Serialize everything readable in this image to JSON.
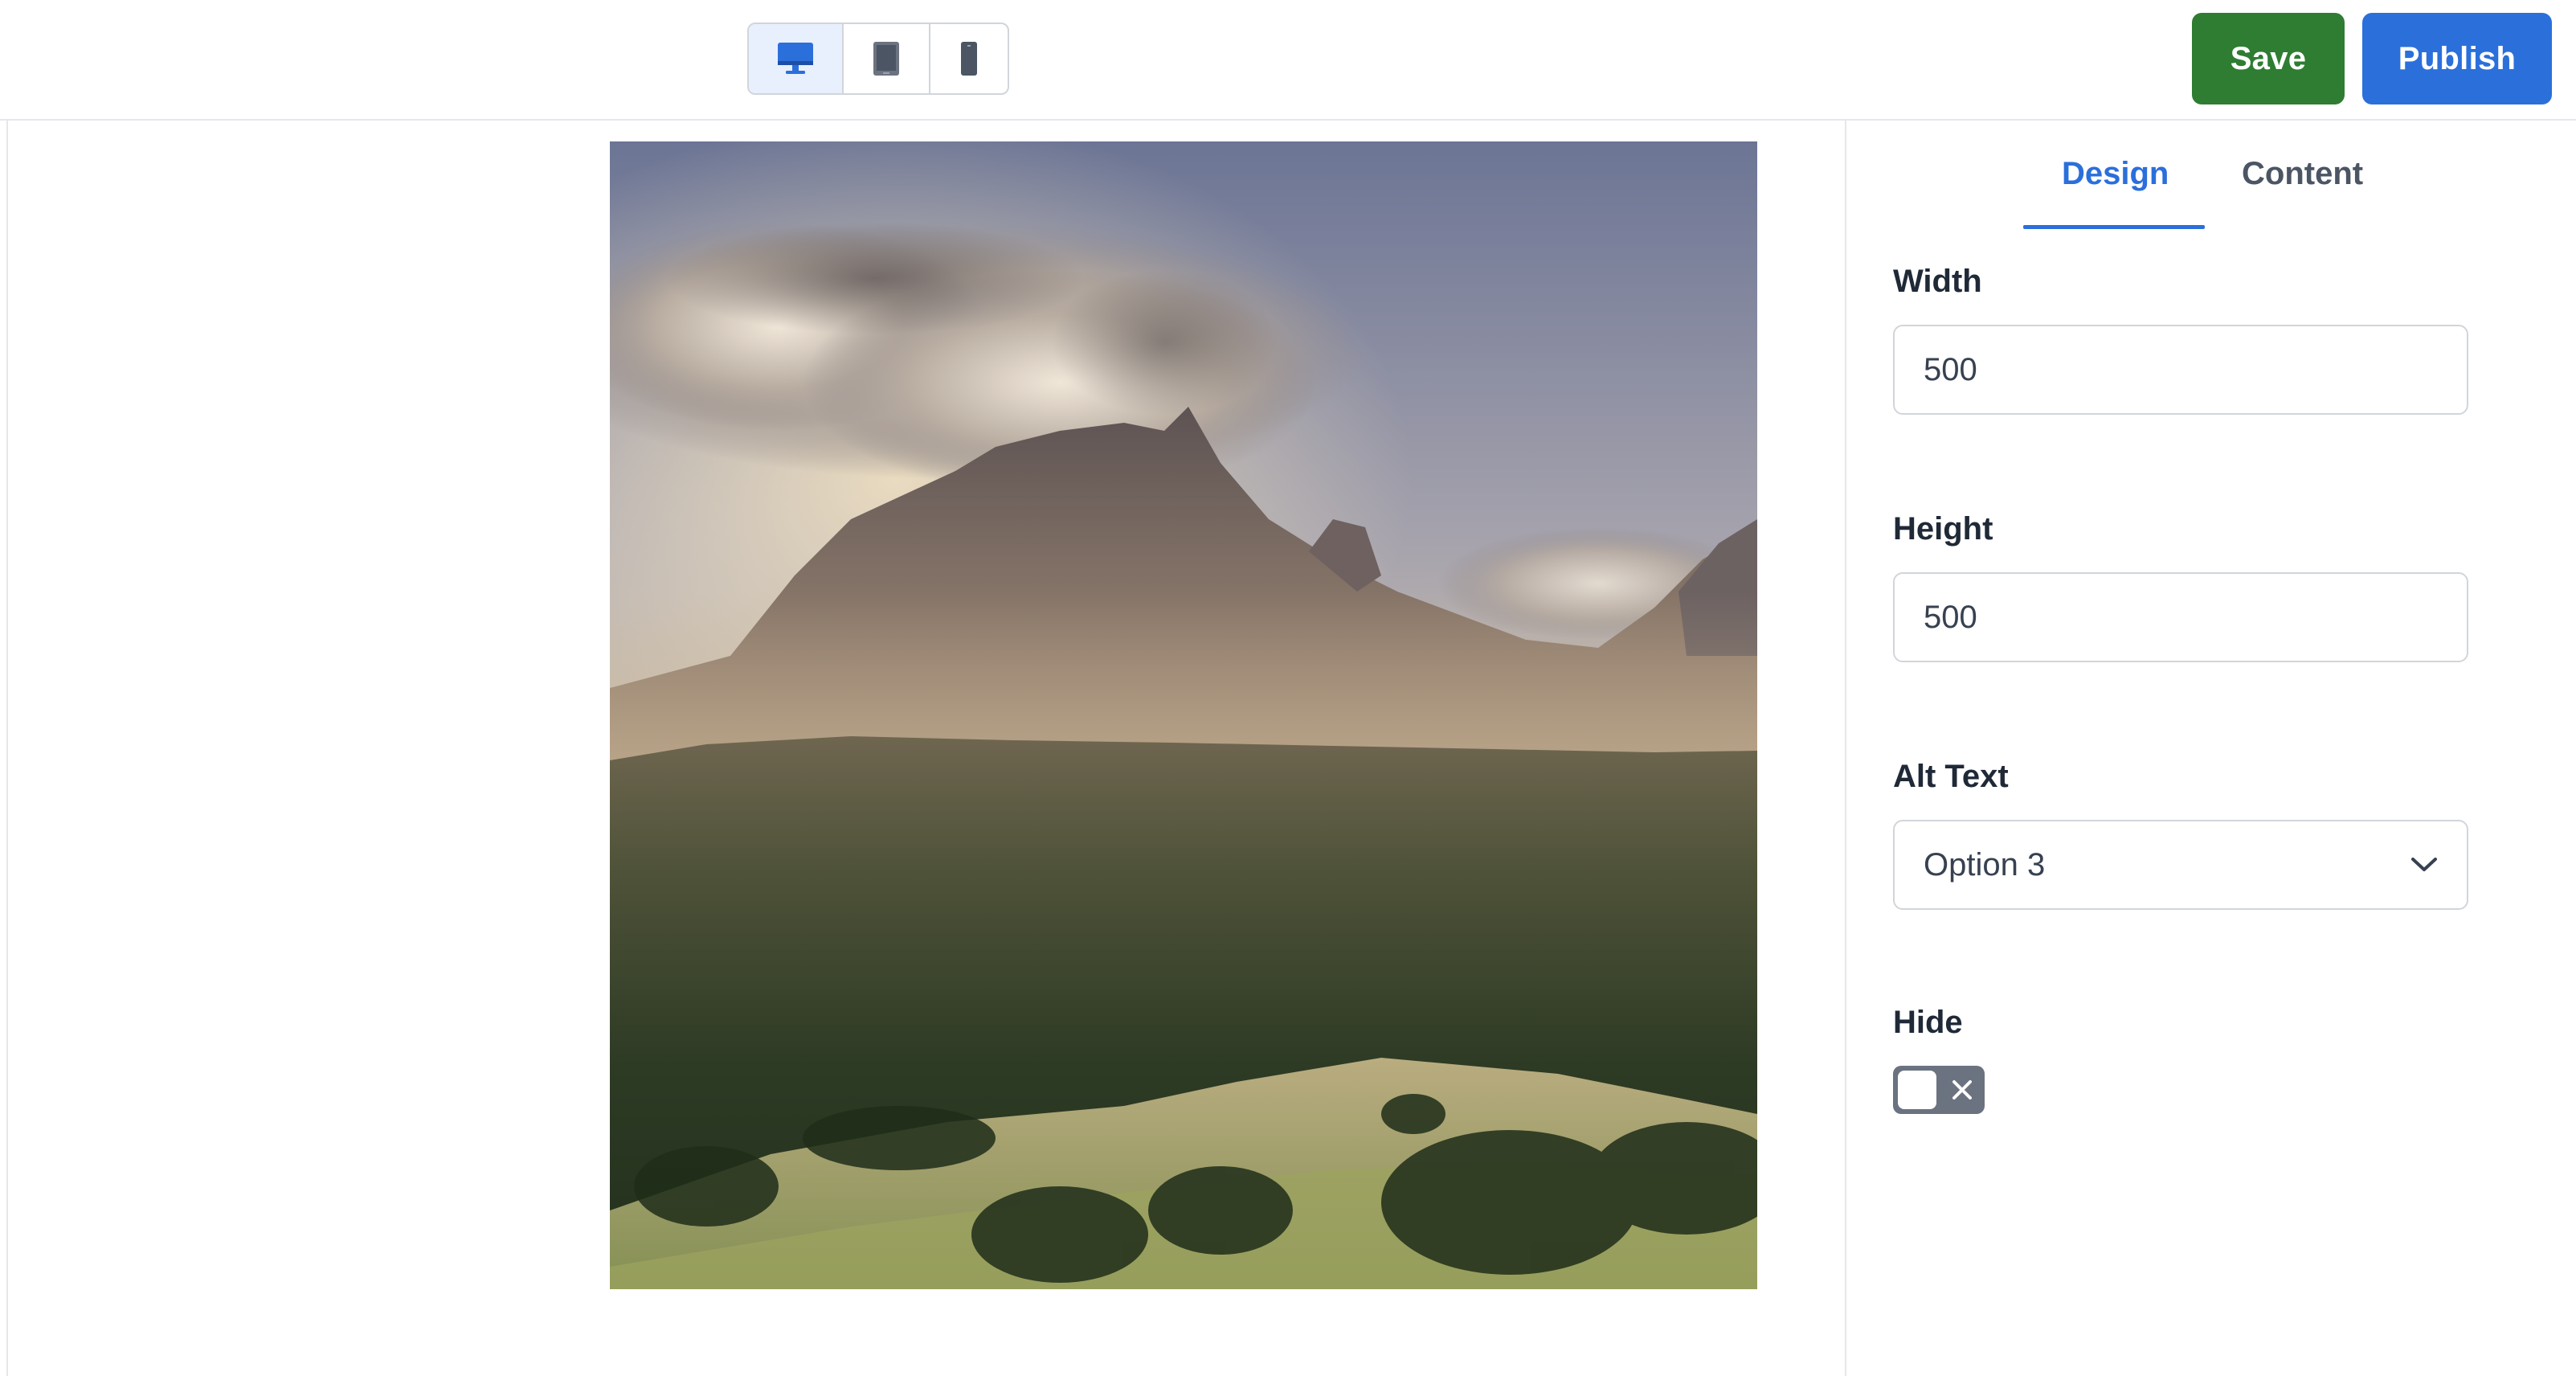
{
  "toolbar": {
    "devices": [
      {
        "name": "desktop",
        "icon": "desktop-icon",
        "active": true
      },
      {
        "name": "tablet",
        "icon": "tablet-icon",
        "active": false
      },
      {
        "name": "mobile",
        "icon": "mobile-icon",
        "active": false
      }
    ],
    "save_label": "Save",
    "publish_label": "Publish"
  },
  "colors": {
    "save": "#2e7d32",
    "publish": "#2b6fdb",
    "accent": "#2b6fdb",
    "toggle_off": "#6b7280"
  },
  "canvas": {
    "image_icon": "mountain-landscape-photo"
  },
  "panel": {
    "tabs": [
      {
        "label": "Design",
        "active": true
      },
      {
        "label": "Content",
        "active": false
      }
    ],
    "width": {
      "label": "Width",
      "value": "500"
    },
    "height": {
      "label": "Height",
      "value": "500"
    },
    "alt_text": {
      "label": "Alt Text",
      "value": "Option 3"
    },
    "hide": {
      "label": "Hide",
      "checked": false
    }
  }
}
